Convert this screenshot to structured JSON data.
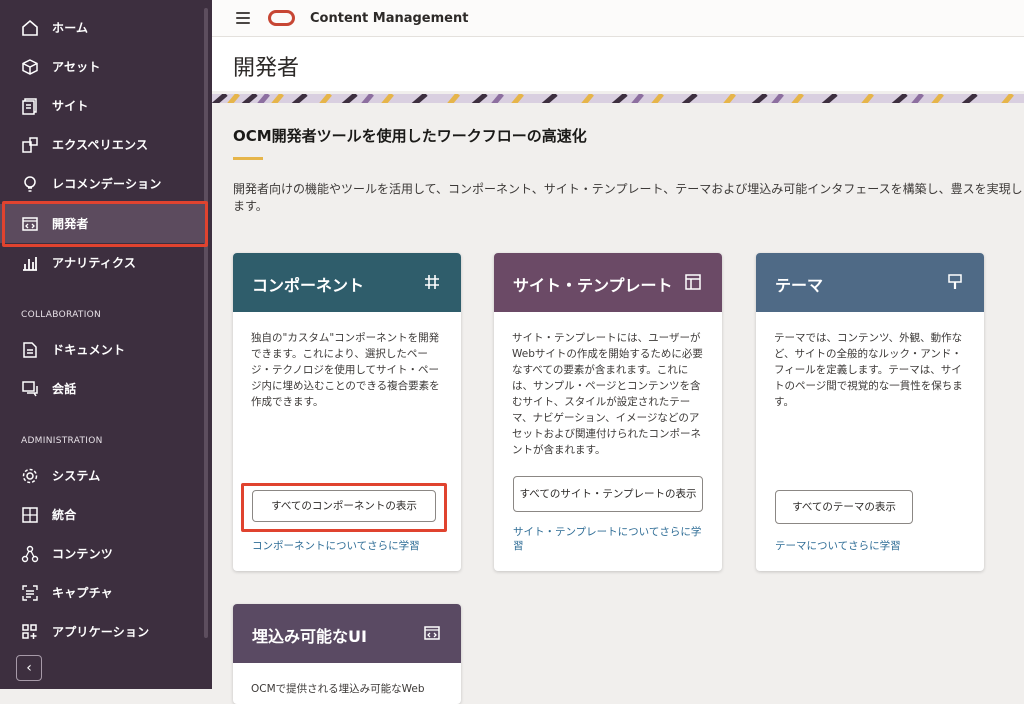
{
  "sidebar": {
    "items": [
      {
        "label": "ホーム",
        "icon": "home-icon"
      },
      {
        "label": "アセット",
        "icon": "cube-icon"
      },
      {
        "label": "サイト",
        "icon": "site-icon"
      },
      {
        "label": "エクスペリエンス",
        "icon": "experience-icon"
      },
      {
        "label": "レコメンデーション",
        "icon": "lightbulb-icon"
      },
      {
        "label": "開発者",
        "icon": "code-window-icon",
        "active": true
      },
      {
        "label": "アナリティクス",
        "icon": "bar-chart-icon"
      }
    ],
    "collaboration_header": "COLLABORATION",
    "collaboration_items": [
      {
        "label": "ドキュメント",
        "icon": "document-icon"
      },
      {
        "label": "会話",
        "icon": "conversation-icon"
      }
    ],
    "administration_header": "ADMINISTRATION",
    "administration_items": [
      {
        "label": "システム",
        "icon": "gear-icon"
      },
      {
        "label": "統合",
        "icon": "integration-icon"
      },
      {
        "label": "コンテンツ",
        "icon": "content-network-icon"
      },
      {
        "label": "キャプチャ",
        "icon": "capture-icon"
      },
      {
        "label": "アプリケーション",
        "icon": "apps-icon"
      }
    ],
    "collapse_glyph": "‹"
  },
  "header": {
    "app_title": "Content Management",
    "page_title": "開発者"
  },
  "main": {
    "heading": "OCM開発者ツールを使用したワークフローの高速化",
    "intro": "開発者向けの機能やツールを活用して、コンポーネント、サイト・テンプレート、テーマおよび埋込み可能インタフェースを構築し、豊スを実現します。",
    "cards": [
      {
        "title": "コンポーネント",
        "icon": "hash-icon",
        "color": "#2f5d6b",
        "body": "独自の\"カスタム\"コンポーネントを開発できます。これにより、選択したページ・テクノロジを使用してサイト・ページ内に埋め込むことのできる複合要素を作成できます。",
        "button": "すべてのコンポーネントの表示",
        "link": "コンポーネントについてさらに学習"
      },
      {
        "title": "サイト・テンプレート",
        "icon": "layout-icon",
        "color": "#6b4a66",
        "body": "サイト・テンプレートには、ユーザーがWebサイトの作成を開始するために必要なすべての要素が含まれます。これには、サンプル・ページとコンテンツを含むサイト、スタイルが設定されたテーマ、ナビゲーション、イメージなどのアセットおよび関連付けられたコンポーネントが含まれます。",
        "button": "すべてのサイト・テンプレートの表示",
        "link": "サイト・テンプレートについてさらに学習"
      },
      {
        "title": "テーマ",
        "icon": "brush-icon",
        "color": "#4f6a86",
        "body": "テーマでは、コンテンツ、外観、動作など、サイトの全般的なルック・アンド・フィールを定義します。テーマは、サイトのページ間で視覚的な一貫性を保ちます。",
        "button": "すべてのテーマの表示",
        "link": "テーマについてさらに学習"
      },
      {
        "title": "埋込み可能なUI",
        "icon": "embed-icon",
        "color": "#5a4a63",
        "body": "OCMで提供される埋込み可能なWeb"
      }
    ]
  },
  "colors": {
    "sidebar": "#3d2f3f",
    "highlight": "#e0432f",
    "accent": "#e6b54a",
    "link": "#2f6d96",
    "brand": "#c74634"
  }
}
